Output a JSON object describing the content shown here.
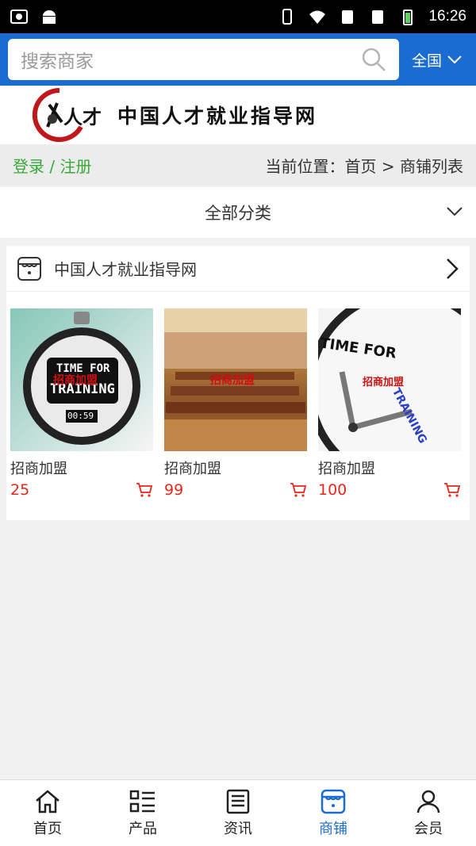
{
  "status_bar": {
    "time": "16:26"
  },
  "search": {
    "placeholder": "搜索商家",
    "region": "全国"
  },
  "banner": {
    "title": "中国人才就业指导网",
    "logo_text": "人才"
  },
  "nav": {
    "login": "登录 / 注册",
    "breadcrumb": "当前位置：首页 > 商铺列表"
  },
  "category": {
    "label": "全部分类"
  },
  "shop": {
    "name": "中国人才就业指导网",
    "products": [
      {
        "name": "招商加盟",
        "price": "25",
        "overlay": "招商加盟",
        "image": "stopwatch"
      },
      {
        "name": "招商加盟",
        "price": "99",
        "overlay": "招商加盟",
        "image": "conference-room"
      },
      {
        "name": "招商加盟",
        "price": "100",
        "overlay": "招商加盟",
        "image": "clock"
      }
    ],
    "image_text": {
      "time_for": "TIME FOR",
      "training": "TRAINING",
      "timer": "00:59"
    }
  },
  "bottom_nav": [
    {
      "label": "首页",
      "icon": "home-icon",
      "active": false
    },
    {
      "label": "产品",
      "icon": "list-icon",
      "active": false
    },
    {
      "label": "资讯",
      "icon": "news-icon",
      "active": false
    },
    {
      "label": "商铺",
      "icon": "shop-icon",
      "active": true
    },
    {
      "label": "会员",
      "icon": "user-icon",
      "active": false
    }
  ],
  "colors": {
    "primary": "#1b6cd1",
    "login_green": "#3aa838",
    "price_red": "#e8261b"
  }
}
